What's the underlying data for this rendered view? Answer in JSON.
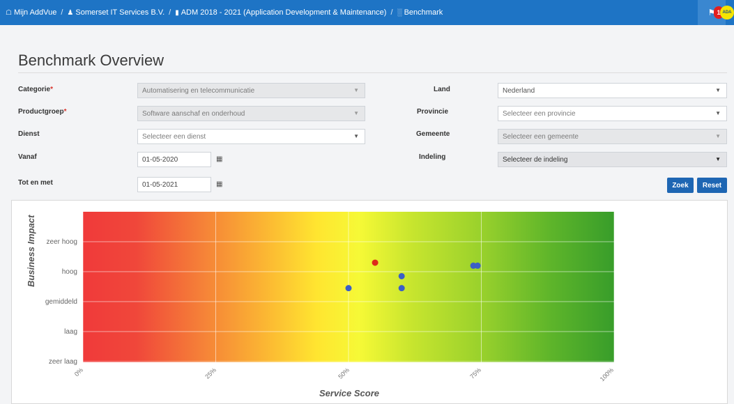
{
  "breadcrumb": {
    "home": "Mijn AddVue",
    "org": "Somerset IT Services B.V.",
    "contract": "ADM 2018 - 2021 (Application Development & Maintenance)",
    "page": "Benchmark",
    "separator": "/"
  },
  "topbar": {
    "notification_count": "1",
    "avatar_text": "ADA",
    "accent_color": "#1e74c5"
  },
  "page_title": "Benchmark Overview",
  "form": {
    "categorie": {
      "label": "Categorie",
      "value": "Automatisering en telecommunicatie"
    },
    "productgroep": {
      "label": "Productgroep",
      "value": "Software aanschaf en onderhoud"
    },
    "dienst": {
      "label": "Dienst",
      "placeholder": "Selecteer een dienst"
    },
    "vanaf": {
      "label": "Vanaf",
      "value": "01-05-2020"
    },
    "tot_en_met": {
      "label": "Tot en met",
      "value": "01-05-2021"
    },
    "land": {
      "label": "Land",
      "value": "Nederland"
    },
    "provincie": {
      "label": "Provincie",
      "placeholder": "Selecteer een provincie"
    },
    "gemeente": {
      "label": "Gemeente",
      "placeholder": "Selecteer een gemeente"
    },
    "indeling": {
      "label": "Indeling",
      "placeholder": "Selecteer de indeling"
    },
    "required_marker": "*",
    "search_button": "Zoek",
    "reset_button": "Reset"
  },
  "chart_data": {
    "type": "scatter",
    "xlabel": "Service Score",
    "ylabel": "Business Impact",
    "x_ticks": [
      "0%",
      "25%",
      "50%",
      "75%",
      "100%"
    ],
    "y_categories": [
      "zeer laag",
      "laag",
      "gemiddeld",
      "hoog",
      "zeer hoog"
    ],
    "xlim": [
      0,
      100
    ],
    "ylim": [
      0,
      4
    ],
    "grid": true,
    "background": "red-to-green horizontal gradient",
    "points": [
      {
        "x": 55,
        "y": 3.3,
        "color": "#dd2a1b"
      },
      {
        "x": 73.5,
        "y": 3.2,
        "color": "#3b5fc7"
      },
      {
        "x": 74.3,
        "y": 3.2,
        "color": "#3b5fc7"
      },
      {
        "x": 60,
        "y": 2.85,
        "color": "#3b5fc7"
      },
      {
        "x": 50,
        "y": 2.45,
        "color": "#3b5fc7"
      },
      {
        "x": 60,
        "y": 2.45,
        "color": "#3b5fc7"
      }
    ]
  }
}
